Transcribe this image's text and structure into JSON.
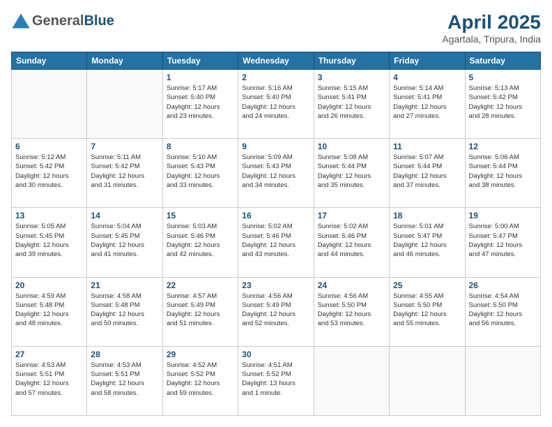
{
  "header": {
    "logo_general": "General",
    "logo_blue": "Blue",
    "month_year": "April 2025",
    "location": "Agartala, Tripura, India"
  },
  "weekdays": [
    "Sunday",
    "Monday",
    "Tuesday",
    "Wednesday",
    "Thursday",
    "Friday",
    "Saturday"
  ],
  "days": [
    {
      "date": "",
      "info": ""
    },
    {
      "date": "",
      "info": ""
    },
    {
      "date": "1",
      "sunrise": "5:17 AM",
      "sunset": "5:40 PM",
      "daylight": "12 hours and 23 minutes."
    },
    {
      "date": "2",
      "sunrise": "5:16 AM",
      "sunset": "5:40 PM",
      "daylight": "12 hours and 24 minutes."
    },
    {
      "date": "3",
      "sunrise": "5:15 AM",
      "sunset": "5:41 PM",
      "daylight": "12 hours and 26 minutes."
    },
    {
      "date": "4",
      "sunrise": "5:14 AM",
      "sunset": "5:41 PM",
      "daylight": "12 hours and 27 minutes."
    },
    {
      "date": "5",
      "sunrise": "5:13 AM",
      "sunset": "5:42 PM",
      "daylight": "12 hours and 28 minutes."
    },
    {
      "date": "6",
      "sunrise": "5:12 AM",
      "sunset": "5:42 PM",
      "daylight": "12 hours and 30 minutes."
    },
    {
      "date": "7",
      "sunrise": "5:11 AM",
      "sunset": "5:42 PM",
      "daylight": "12 hours and 31 minutes."
    },
    {
      "date": "8",
      "sunrise": "5:10 AM",
      "sunset": "5:43 PM",
      "daylight": "12 hours and 33 minutes."
    },
    {
      "date": "9",
      "sunrise": "5:09 AM",
      "sunset": "5:43 PM",
      "daylight": "12 hours and 34 minutes."
    },
    {
      "date": "10",
      "sunrise": "5:08 AM",
      "sunset": "5:44 PM",
      "daylight": "12 hours and 35 minutes."
    },
    {
      "date": "11",
      "sunrise": "5:07 AM",
      "sunset": "5:44 PM",
      "daylight": "12 hours and 37 minutes."
    },
    {
      "date": "12",
      "sunrise": "5:06 AM",
      "sunset": "5:44 PM",
      "daylight": "12 hours and 38 minutes."
    },
    {
      "date": "13",
      "sunrise": "5:05 AM",
      "sunset": "5:45 PM",
      "daylight": "12 hours and 39 minutes."
    },
    {
      "date": "14",
      "sunrise": "5:04 AM",
      "sunset": "5:45 PM",
      "daylight": "12 hours and 41 minutes."
    },
    {
      "date": "15",
      "sunrise": "5:03 AM",
      "sunset": "5:46 PM",
      "daylight": "12 hours and 42 minutes."
    },
    {
      "date": "16",
      "sunrise": "5:02 AM",
      "sunset": "5:46 PM",
      "daylight": "12 hours and 43 minutes."
    },
    {
      "date": "17",
      "sunrise": "5:02 AM",
      "sunset": "5:46 PM",
      "daylight": "12 hours and 44 minutes."
    },
    {
      "date": "18",
      "sunrise": "5:01 AM",
      "sunset": "5:47 PM",
      "daylight": "12 hours and 46 minutes."
    },
    {
      "date": "19",
      "sunrise": "5:00 AM",
      "sunset": "5:47 PM",
      "daylight": "12 hours and 47 minutes."
    },
    {
      "date": "20",
      "sunrise": "4:59 AM",
      "sunset": "5:48 PM",
      "daylight": "12 hours and 48 minutes."
    },
    {
      "date": "21",
      "sunrise": "4:58 AM",
      "sunset": "5:48 PM",
      "daylight": "12 hours and 50 minutes."
    },
    {
      "date": "22",
      "sunrise": "4:57 AM",
      "sunset": "5:49 PM",
      "daylight": "12 hours and 51 minutes."
    },
    {
      "date": "23",
      "sunrise": "4:56 AM",
      "sunset": "5:49 PM",
      "daylight": "12 hours and 52 minutes."
    },
    {
      "date": "24",
      "sunrise": "4:56 AM",
      "sunset": "5:50 PM",
      "daylight": "12 hours and 53 minutes."
    },
    {
      "date": "25",
      "sunrise": "4:55 AM",
      "sunset": "5:50 PM",
      "daylight": "12 hours and 55 minutes."
    },
    {
      "date": "26",
      "sunrise": "4:54 AM",
      "sunset": "5:50 PM",
      "daylight": "12 hours and 56 minutes."
    },
    {
      "date": "27",
      "sunrise": "4:53 AM",
      "sunset": "5:51 PM",
      "daylight": "12 hours and 57 minutes."
    },
    {
      "date": "28",
      "sunrise": "4:53 AM",
      "sunset": "5:51 PM",
      "daylight": "12 hours and 58 minutes."
    },
    {
      "date": "29",
      "sunrise": "4:52 AM",
      "sunset": "5:52 PM",
      "daylight": "12 hours and 59 minutes."
    },
    {
      "date": "30",
      "sunrise": "4:51 AM",
      "sunset": "5:52 PM",
      "daylight": "13 hours and 1 minute."
    },
    {
      "date": "",
      "info": ""
    },
    {
      "date": "",
      "info": ""
    },
    {
      "date": "",
      "info": ""
    },
    {
      "date": "",
      "info": ""
    }
  ],
  "labels": {
    "sunrise": "Sunrise:",
    "sunset": "Sunset:",
    "daylight": "Daylight:"
  }
}
